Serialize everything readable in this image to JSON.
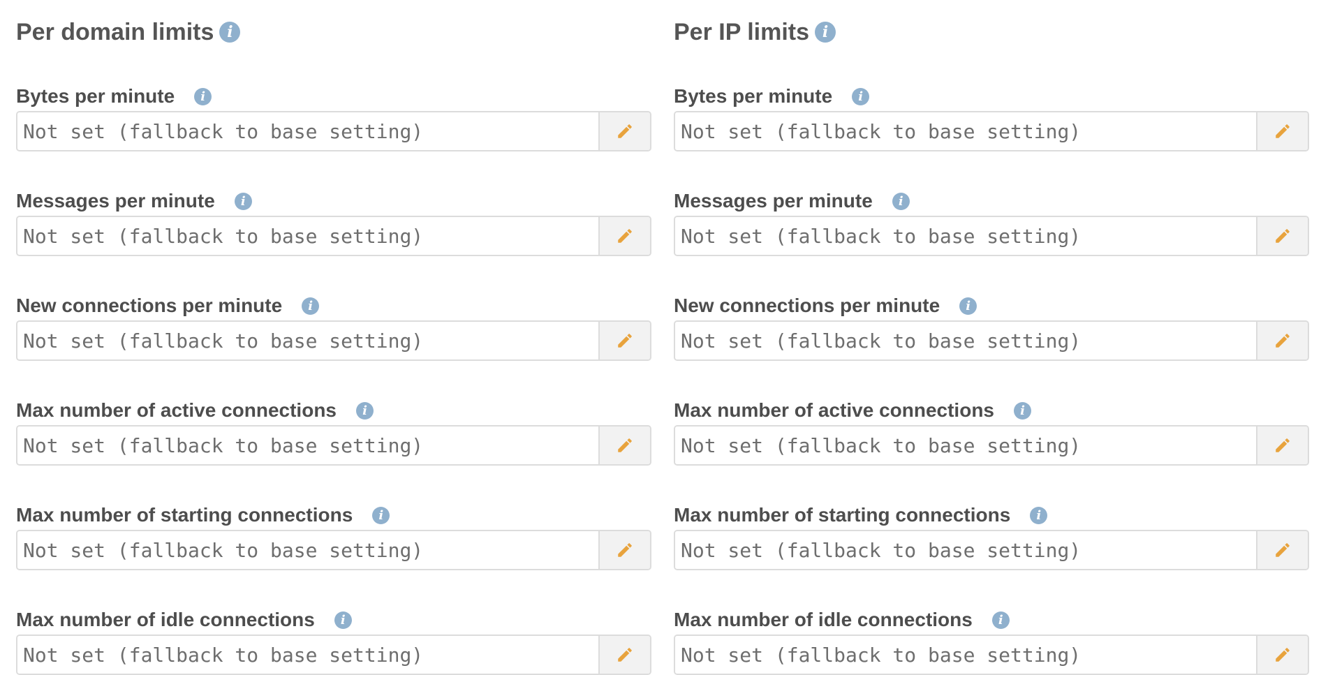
{
  "columns": [
    {
      "title": "Per domain limits",
      "fields": [
        {
          "label": "Bytes per minute",
          "value": "",
          "placeholder": "Not set (fallback to base setting)"
        },
        {
          "label": "Messages per minute",
          "value": "",
          "placeholder": "Not set (fallback to base setting)"
        },
        {
          "label": "New connections per minute",
          "value": "",
          "placeholder": "Not set (fallback to base setting)"
        },
        {
          "label": "Max number of active connections",
          "value": "",
          "placeholder": "Not set (fallback to base setting)"
        },
        {
          "label": "Max number of starting connections",
          "value": "",
          "placeholder": "Not set (fallback to base setting)"
        },
        {
          "label": "Max number of idle connections",
          "value": "",
          "placeholder": "Not set (fallback to base setting)"
        }
      ]
    },
    {
      "title": "Per IP limits",
      "fields": [
        {
          "label": "Bytes per minute",
          "value": "",
          "placeholder": "Not set (fallback to base setting)"
        },
        {
          "label": "Messages per minute",
          "value": "",
          "placeholder": "Not set (fallback to base setting)"
        },
        {
          "label": "New connections per minute",
          "value": "",
          "placeholder": "Not set (fallback to base setting)"
        },
        {
          "label": "Max number of active connections",
          "value": "",
          "placeholder": "Not set (fallback to base setting)"
        },
        {
          "label": "Max number of starting connections",
          "value": "",
          "placeholder": "Not set (fallback to base setting)"
        },
        {
          "label": "Max number of idle connections",
          "value": "",
          "placeholder": "Not set (fallback to base setting)"
        }
      ]
    }
  ],
  "icons": {
    "info": "info-icon",
    "edit": "pencil-icon"
  },
  "colors": {
    "info_icon": "#8fb0cd",
    "pencil": "#e8a33d",
    "heading_text": "#555555",
    "input_border": "#dcdcdc",
    "addon_background": "#f2f2f2"
  }
}
